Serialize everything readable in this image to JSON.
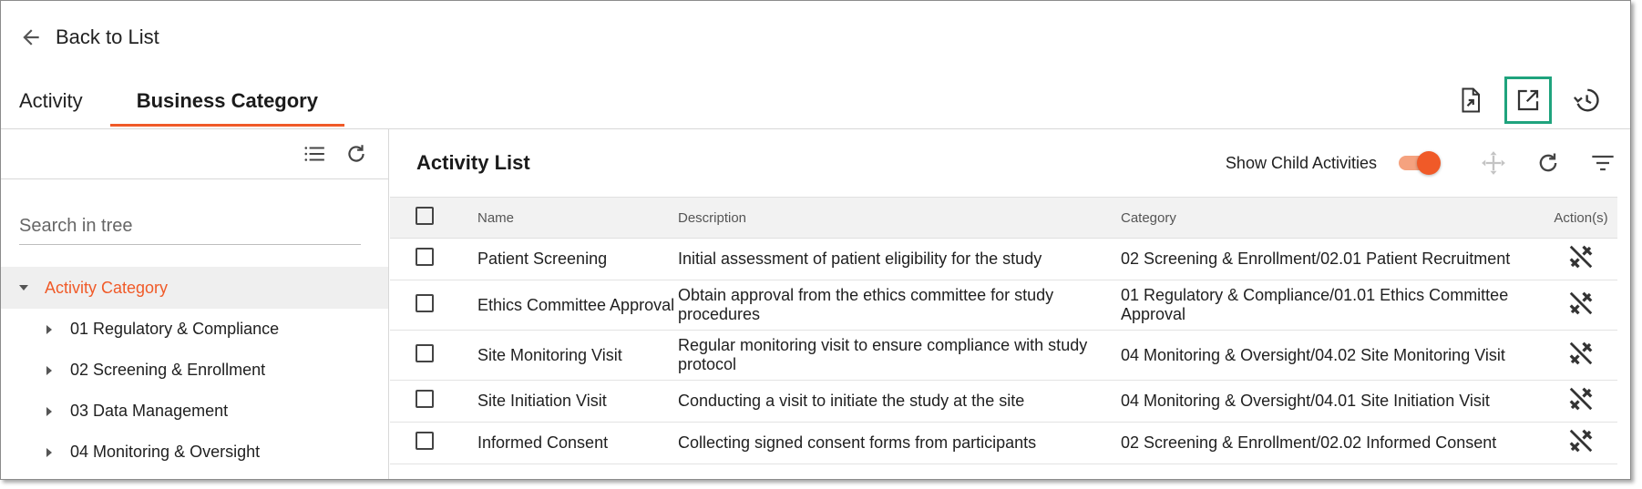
{
  "header": {
    "back_label": "Back to List"
  },
  "tabs": [
    {
      "label": "Activity",
      "active": false
    },
    {
      "label": "Business Category",
      "active": true
    }
  ],
  "top_actions": [
    {
      "icon": "export-file-icon"
    },
    {
      "icon": "open-external-icon",
      "highlighted": true
    },
    {
      "icon": "history-icon"
    }
  ],
  "tree": {
    "search_placeholder": "Search in tree",
    "root": {
      "label": "Activity Category",
      "expanded": true
    },
    "children": [
      {
        "label": "01 Regulatory & Compliance"
      },
      {
        "label": "02 Screening & Enrollment"
      },
      {
        "label": "03 Data Management"
      },
      {
        "label": "04 Monitoring & Oversight"
      }
    ]
  },
  "main": {
    "title": "Activity List",
    "show_child_label": "Show Child Activities",
    "show_child_on": true,
    "columns": {
      "name": "Name",
      "description": "Description",
      "category": "Category",
      "actions": "Action(s)"
    },
    "rows": [
      {
        "name": "Patient Screening",
        "description": "Initial assessment of patient eligibility for the study",
        "category": "02 Screening & Enrollment/02.01 Patient Recruitment"
      },
      {
        "name": "Ethics Committee Approval",
        "description": "Obtain approval from the ethics committee for study procedures",
        "category": "01 Regulatory & Compliance/01.01 Ethics Committee Approval"
      },
      {
        "name": "Site Monitoring Visit",
        "description": "Regular monitoring visit to ensure compliance with study protocol",
        "category": "04 Monitoring & Oversight/04.02 Site Monitoring Visit"
      },
      {
        "name": "Site Initiation Visit",
        "description": "Conducting a visit to initiate the study at the site",
        "category": "04 Monitoring & Oversight/04.01 Site Initiation Visit"
      },
      {
        "name": "Informed Consent",
        "description": "Collecting signed consent forms from participants",
        "category": "02 Screening & Enrollment/02.02 Informed Consent"
      }
    ]
  },
  "colors": {
    "accent": "#f05a28",
    "highlight_border": "#1fa37d"
  }
}
